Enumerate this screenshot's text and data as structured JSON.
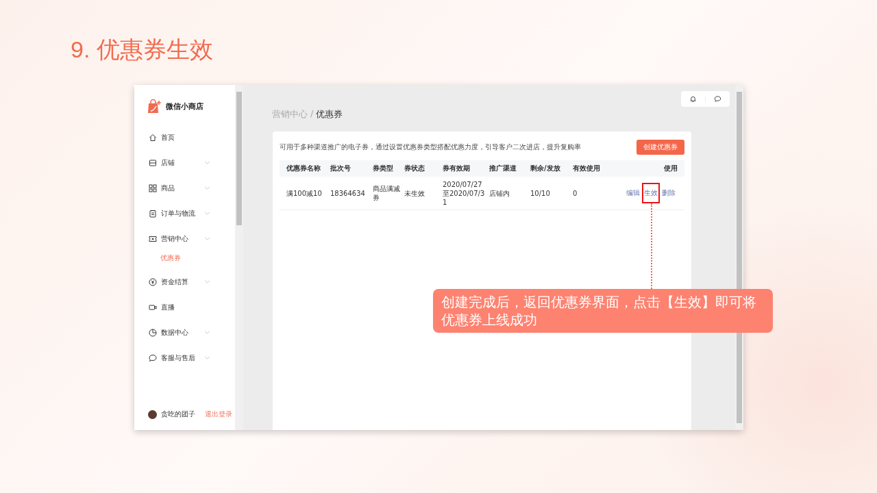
{
  "slide_title": "9. 优惠券生效",
  "app": {
    "brand": "微信小商店",
    "nav": [
      {
        "label": "首页",
        "kind": "home",
        "expandable": false,
        "selected": false
      },
      {
        "label": "店铺",
        "kind": "shop",
        "expandable": true,
        "selected": false
      },
      {
        "label": "商品",
        "kind": "grid",
        "expandable": true,
        "selected": false
      },
      {
        "label": "订单与物流",
        "kind": "order",
        "expandable": true,
        "selected": false
      },
      {
        "label": "营销中心",
        "kind": "ticket",
        "expandable": true,
        "selected": false,
        "children": [
          {
            "label": "优惠券",
            "selected": true
          }
        ]
      },
      {
        "label": "资金结算",
        "kind": "yen",
        "expandable": true,
        "selected": false
      },
      {
        "label": "直播",
        "kind": "video",
        "expandable": false,
        "selected": false
      },
      {
        "label": "数据中心",
        "kind": "chart",
        "expandable": true,
        "selected": false
      },
      {
        "label": "客服与售后",
        "kind": "chat",
        "expandable": true,
        "selected": false
      }
    ],
    "user": "贪吃的团子",
    "logout": "退出登录",
    "breadcrumb_separator": "/",
    "breadcrumb": [
      {
        "label": "营销中心",
        "current": false
      },
      {
        "label": "优惠券",
        "current": true
      }
    ],
    "description": "可用于多种渠道推广的电子券，通过设置优惠券类型搭配优惠力度，引导客户二次进店，提升复购率",
    "create_button": "创建优惠券",
    "table": {
      "columns": [
        "优惠券名称",
        "批次号",
        "券类型",
        "券状态",
        "券有效期",
        "推广渠道",
        "剩余/发放",
        "有效使用",
        "使用"
      ],
      "rows": [
        {
          "cells": [
            "满100减10",
            "18364634",
            "商品满减券",
            "未生效",
            "2020/07/27至2020/07/31",
            "店铺内",
            "10/10",
            "0"
          ],
          "actions": [
            {
              "label": "编辑",
              "selected": false
            },
            {
              "label": "生效",
              "selected": true
            },
            {
              "label": "删除",
              "selected": false
            }
          ]
        }
      ]
    }
  },
  "callout": "创建完成后，返回优惠券界面，点击【生效】即可将优惠券上线成功"
}
